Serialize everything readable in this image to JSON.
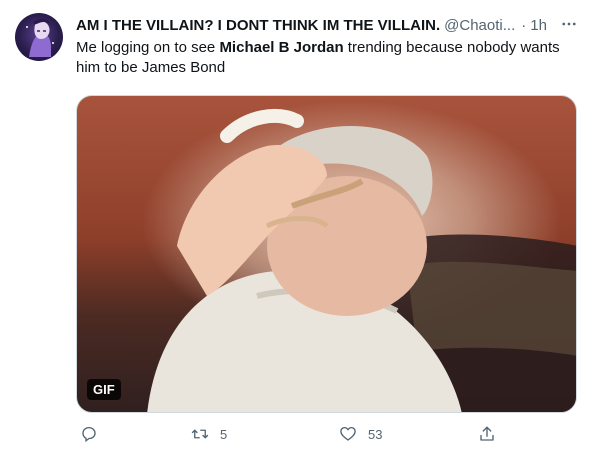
{
  "tweet": {
    "display_name": "AM I THE VILLAIN? I DONT THINK IM THE VILLAIN.",
    "handle": "@Chaoti...",
    "separator": "·",
    "time": "1h",
    "text_part1": "Me logging on to see ",
    "text_bold": "Michael B Jordan",
    "text_part2": " trending because nobody wants him to be James Bond",
    "media_badge": "GIF",
    "actions": {
      "reply_count": "",
      "retweet_count": "5",
      "like_count": "53"
    }
  },
  "icons": {
    "more": "more-horizontal-icon",
    "reply": "reply-icon",
    "retweet": "retweet-icon",
    "like": "heart-icon",
    "share": "share-icon"
  },
  "colors": {
    "text": "#0f1419",
    "secondary": "#536471",
    "border": "#cfd9de"
  }
}
